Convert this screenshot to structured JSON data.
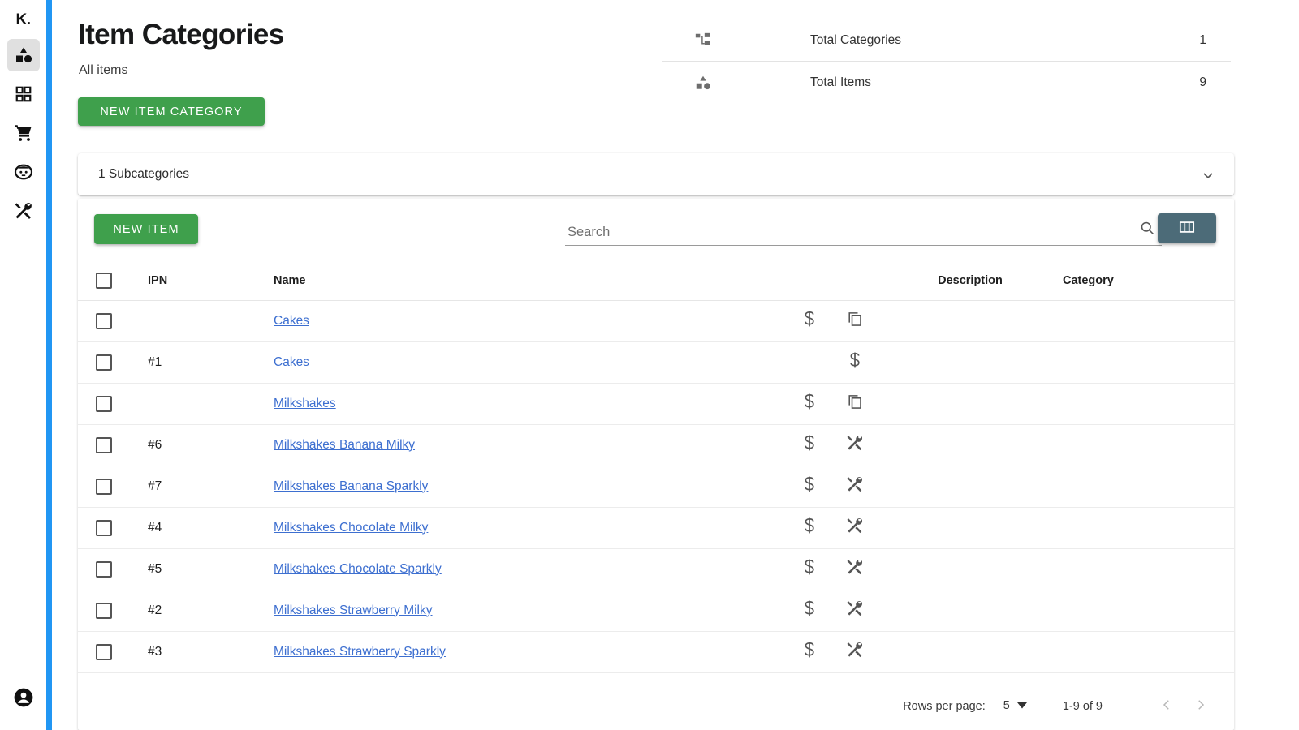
{
  "sidebar": {
    "brand": "K.",
    "items": [
      {
        "icon": "category-icon",
        "name": "sidebar-item-categories",
        "active": true
      },
      {
        "icon": "dashboard-icon",
        "name": "sidebar-item-dashboard",
        "active": false
      },
      {
        "icon": "cart-icon",
        "name": "sidebar-item-orders",
        "active": false
      },
      {
        "icon": "customer-icon",
        "name": "sidebar-item-customers",
        "active": false
      },
      {
        "icon": "tools-icon",
        "name": "sidebar-item-tools",
        "active": false
      }
    ],
    "account_icon": "account-circle-icon"
  },
  "header": {
    "title": "Item Categories",
    "subtitle": "All items",
    "new_category_button": "NEW ITEM CATEGORY"
  },
  "stats": [
    {
      "icon": "account-tree-icon",
      "label": "Total Categories",
      "value": "1"
    },
    {
      "icon": "category-icon",
      "label": "Total Items",
      "value": "9"
    }
  ],
  "subcategories": {
    "label": "1 Subcategories",
    "chevron": "chevron-down-icon"
  },
  "toolbar": {
    "new_item_button": "NEW ITEM",
    "search_placeholder": "Search",
    "search_value": "",
    "search_icon": "search-icon",
    "columns_icon": "columns-icon"
  },
  "table": {
    "columns": [
      "",
      "IPN",
      "Name",
      "",
      "",
      "Description",
      "Category"
    ],
    "rows": [
      {
        "ipn": "",
        "name": "Cakes",
        "icon1": "dollar-icon",
        "icon2": "copy-icon",
        "description": "",
        "category": ""
      },
      {
        "ipn": "#1",
        "name": "Cakes",
        "icon1": "",
        "icon2": "dollar-icon",
        "description": "",
        "category": ""
      },
      {
        "ipn": "",
        "name": "Milkshakes",
        "icon1": "dollar-icon",
        "icon2": "copy-icon",
        "description": "",
        "category": ""
      },
      {
        "ipn": "#6",
        "name": "Milkshakes Banana Milky",
        "icon1": "dollar-icon",
        "icon2": "tools-icon",
        "description": "",
        "category": ""
      },
      {
        "ipn": "#7",
        "name": "Milkshakes Banana Sparkly",
        "icon1": "dollar-icon",
        "icon2": "tools-icon",
        "description": "",
        "category": ""
      },
      {
        "ipn": "#4",
        "name": "Milkshakes Chocolate Milky",
        "icon1": "dollar-icon",
        "icon2": "tools-icon",
        "description": "",
        "category": ""
      },
      {
        "ipn": "#5",
        "name": "Milkshakes Chocolate Sparkly",
        "icon1": "dollar-icon",
        "icon2": "tools-icon",
        "description": "",
        "category": ""
      },
      {
        "ipn": "#2",
        "name": "Milkshakes Strawberry Milky",
        "icon1": "dollar-icon",
        "icon2": "tools-icon",
        "description": "",
        "category": ""
      },
      {
        "ipn": "#3",
        "name": "Milkshakes Strawberry Sparkly",
        "icon1": "dollar-icon",
        "icon2": "tools-icon",
        "description": "",
        "category": ""
      }
    ]
  },
  "pagination": {
    "rows_per_page_label": "Rows per page:",
    "rows_per_page_value": "5",
    "range": "1-9 of 9",
    "prev_icon": "chevron-left-icon",
    "next_icon": "chevron-right-icon"
  },
  "colors": {
    "accent_blue": "#2196f3",
    "green": "#3fa04c",
    "slate": "#4c6b78",
    "link": "#3d6fd0"
  }
}
